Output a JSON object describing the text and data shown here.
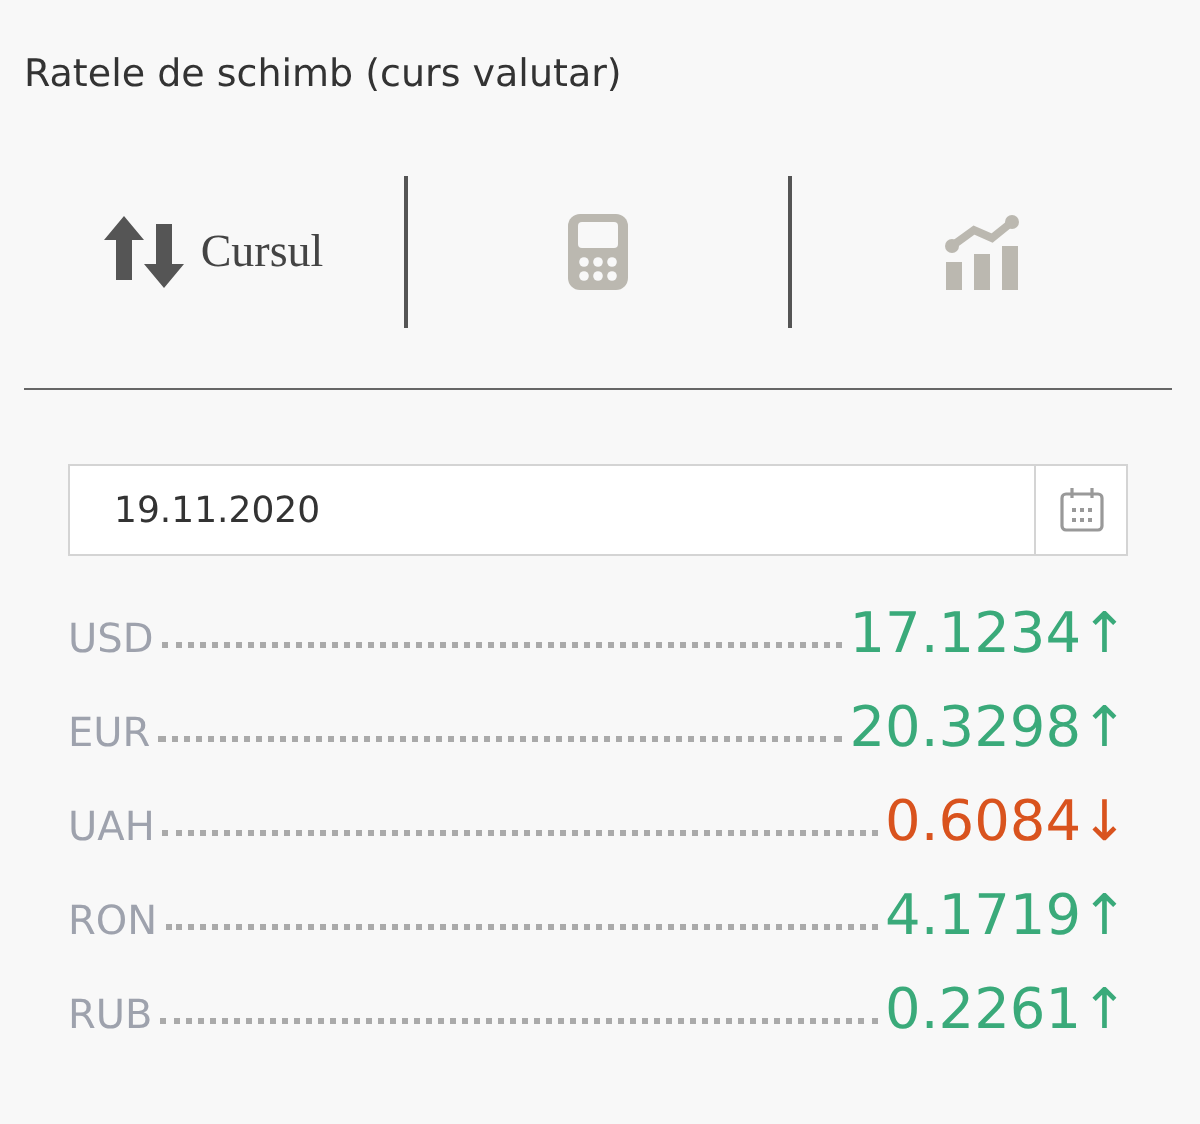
{
  "title": "Ratele de schimb (curs valutar)",
  "tabs": [
    {
      "kind": "rates",
      "label": "Cursul",
      "selected": true
    },
    {
      "kind": "calculator",
      "selected": false
    },
    {
      "kind": "chart",
      "selected": false
    }
  ],
  "date_field": {
    "value": "19.11.2020"
  },
  "rates": [
    {
      "currency": "USD",
      "value": "17.1234",
      "arrow": "↑",
      "kind": "up"
    },
    {
      "currency": "EUR",
      "value": "20.3298",
      "arrow": "↑",
      "kind": "up"
    },
    {
      "currency": "UAH",
      "value": "0.6084",
      "arrow": "↓",
      "kind": "down"
    },
    {
      "currency": "RON",
      "value": "4.1719",
      "arrow": "↑",
      "kind": "up"
    },
    {
      "currency": "RUB",
      "value": "0.2261",
      "arrow": "↑",
      "kind": "up"
    }
  ]
}
